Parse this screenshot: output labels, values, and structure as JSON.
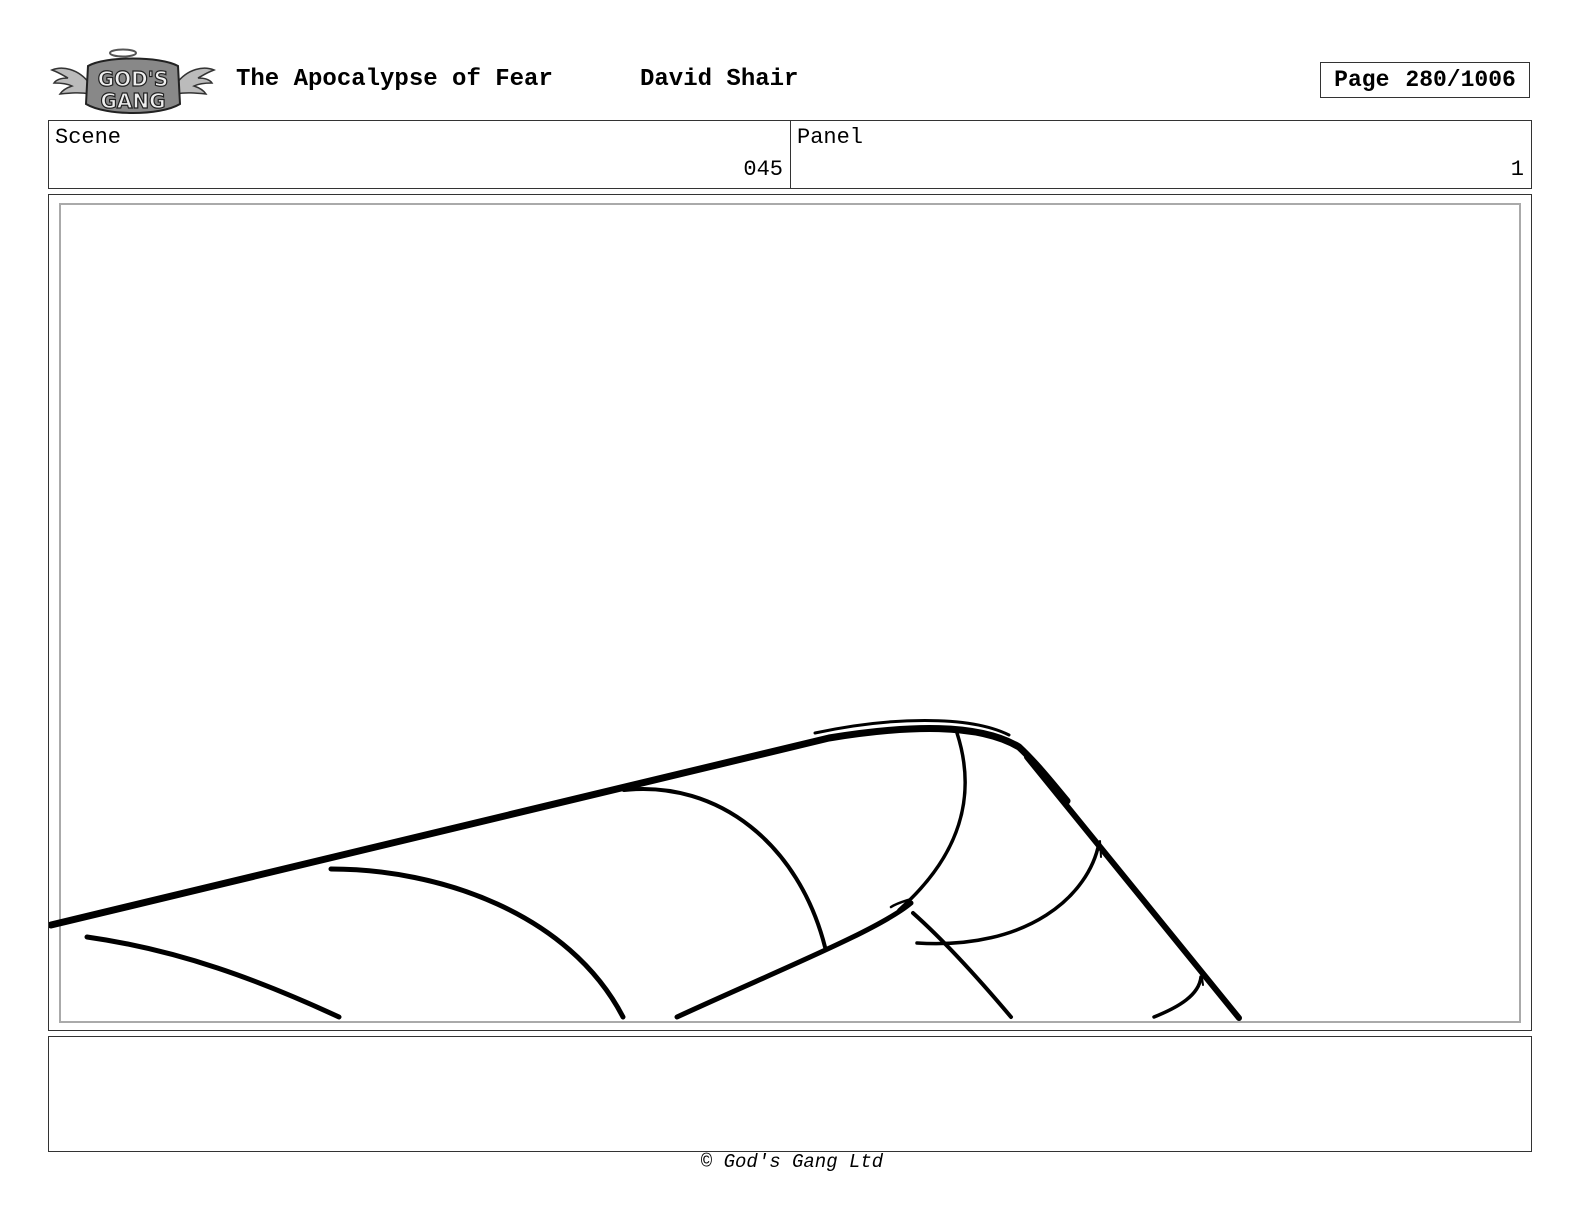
{
  "header": {
    "logo_text": "GOD'S GANG",
    "title": "The Apocalypse of Fear",
    "author": "David Shair",
    "page_label": "Page",
    "page_number": "280/1006"
  },
  "info": {
    "scene_label": "Scene",
    "scene_value": "045",
    "panel_label": "Panel",
    "panel_value": "1"
  },
  "notes": {
    "text": ""
  },
  "footer": {
    "copyright": "© God's Gang Ltd"
  }
}
